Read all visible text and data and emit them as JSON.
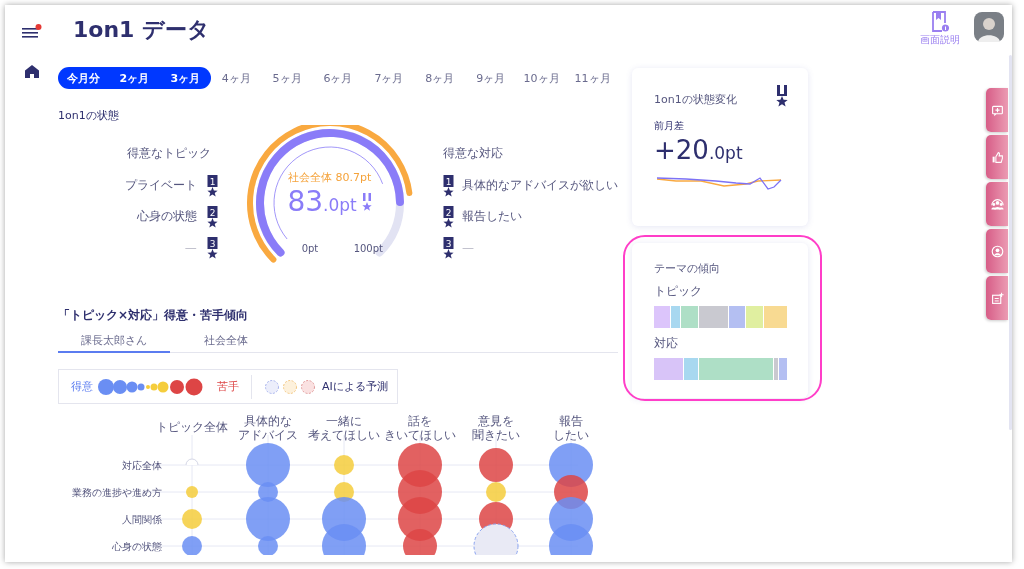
{
  "header": {
    "title": "1on1 データ",
    "help_label": "画面説明"
  },
  "periods": [
    {
      "label": "今月分",
      "selected": true
    },
    {
      "label": "2ヶ月",
      "selected": true
    },
    {
      "label": "3ヶ月",
      "selected": true
    },
    {
      "label": "4ヶ月",
      "selected": false
    },
    {
      "label": "5ヶ月",
      "selected": false
    },
    {
      "label": "6ヶ月",
      "selected": false
    },
    {
      "label": "7ヶ月",
      "selected": false
    },
    {
      "label": "8ヶ月",
      "selected": false
    },
    {
      "label": "9ヶ月",
      "selected": false
    },
    {
      "label": "10ヶ月",
      "selected": false
    },
    {
      "label": "11ヶ月",
      "selected": false
    }
  ],
  "status": {
    "title": "1on1の状態",
    "topics": {
      "heading": "得意なトピック",
      "items": [
        {
          "label": "プライベート",
          "rank": "1"
        },
        {
          "label": "心身の状態",
          "rank": "2"
        },
        {
          "label": "—",
          "rank": "3"
        }
      ]
    },
    "responses": {
      "heading": "得意な対応",
      "items": [
        {
          "label": "具体的なアドバイスが欲しい",
          "rank": "1"
        },
        {
          "label": "報告したい",
          "rank": "2"
        },
        {
          "label": "—",
          "rank": "3"
        }
      ]
    },
    "gauge": {
      "value": "83",
      "unit": ".0pt",
      "society": {
        "label": "社会全体 80.7pt"
      },
      "min_label": "0pt",
      "max_label": "100pt"
    }
  },
  "change_card": {
    "title": "1on1の状態変化",
    "subtitle": "前月差",
    "value": "+20",
    "unit": ".0pt"
  },
  "theme_card": {
    "title": "テーマの傾向",
    "bars": [
      {
        "label": "トピック",
        "segments": [
          {
            "color": "#dcc5fb"
          },
          {
            "color": "#a8d8f0"
          },
          {
            "color": "#aedfc6"
          },
          {
            "color": "#c9c9d0"
          },
          {
            "color": "#b4bff2"
          },
          {
            "color": "#e0efa0"
          },
          {
            "color": "#f8da92"
          }
        ]
      },
      {
        "label": "対応",
        "segments": [
          {
            "color": "#d8c4f8"
          },
          {
            "color": "#a8d8f0"
          },
          {
            "color": "#aedfc6"
          },
          {
            "color": "#c9c9d0"
          },
          {
            "color": "#b4bff2"
          }
        ]
      }
    ]
  },
  "bubble_section": {
    "title": "「トピック×対応」得意・苦手傾向",
    "tabs": [
      {
        "label": "課長太郎さん",
        "selected": true
      },
      {
        "label": "社会全体",
        "selected": false
      }
    ],
    "legend": {
      "good_label": "得意",
      "bad_label": "苦手",
      "ai_label": "AIによる予測"
    },
    "columns": [
      {
        "lines": [
          "トピック全体"
        ]
      },
      {
        "lines": [
          "具体的な",
          "アドバイス"
        ]
      },
      {
        "lines": [
          "一緒に",
          "考えてほしい"
        ]
      },
      {
        "lines": [
          "話を",
          "きいてほしい"
        ]
      },
      {
        "lines": [
          "意見を",
          "聞きたい"
        ]
      },
      {
        "lines": [
          "報告",
          "したい"
        ]
      }
    ],
    "rows": [
      {
        "label": "対応全体",
        "cells": [
          {
            "kind": "empty"
          },
          {
            "kind": "good-large"
          },
          {
            "kind": "neutral-small"
          },
          {
            "kind": "bad-large"
          },
          {
            "kind": "bad-medium"
          },
          {
            "kind": "good-large"
          }
        ]
      },
      {
        "label": "業務の進捗や進め方",
        "cells": [
          {
            "kind": "neutral-tiny"
          },
          {
            "kind": "good-small"
          },
          {
            "kind": "neutral-small"
          },
          {
            "kind": "bad-large"
          },
          {
            "kind": "neutral-small"
          },
          {
            "kind": "bad-medium"
          }
        ]
      },
      {
        "label": "人間関係",
        "cells": [
          {
            "kind": "neutral-small"
          },
          {
            "kind": "good-large"
          },
          {
            "kind": "good-large"
          },
          {
            "kind": "bad-large"
          },
          {
            "kind": "bad-medium"
          },
          {
            "kind": "good-large"
          }
        ]
      },
      {
        "label": "心身の状態",
        "cells": [
          {
            "kind": "good-small"
          },
          {
            "kind": "good-small"
          },
          {
            "kind": "good-large"
          },
          {
            "kind": "bad-medium"
          },
          {
            "kind": "predicted"
          },
          {
            "kind": "good-large"
          }
        ]
      }
    ]
  }
}
